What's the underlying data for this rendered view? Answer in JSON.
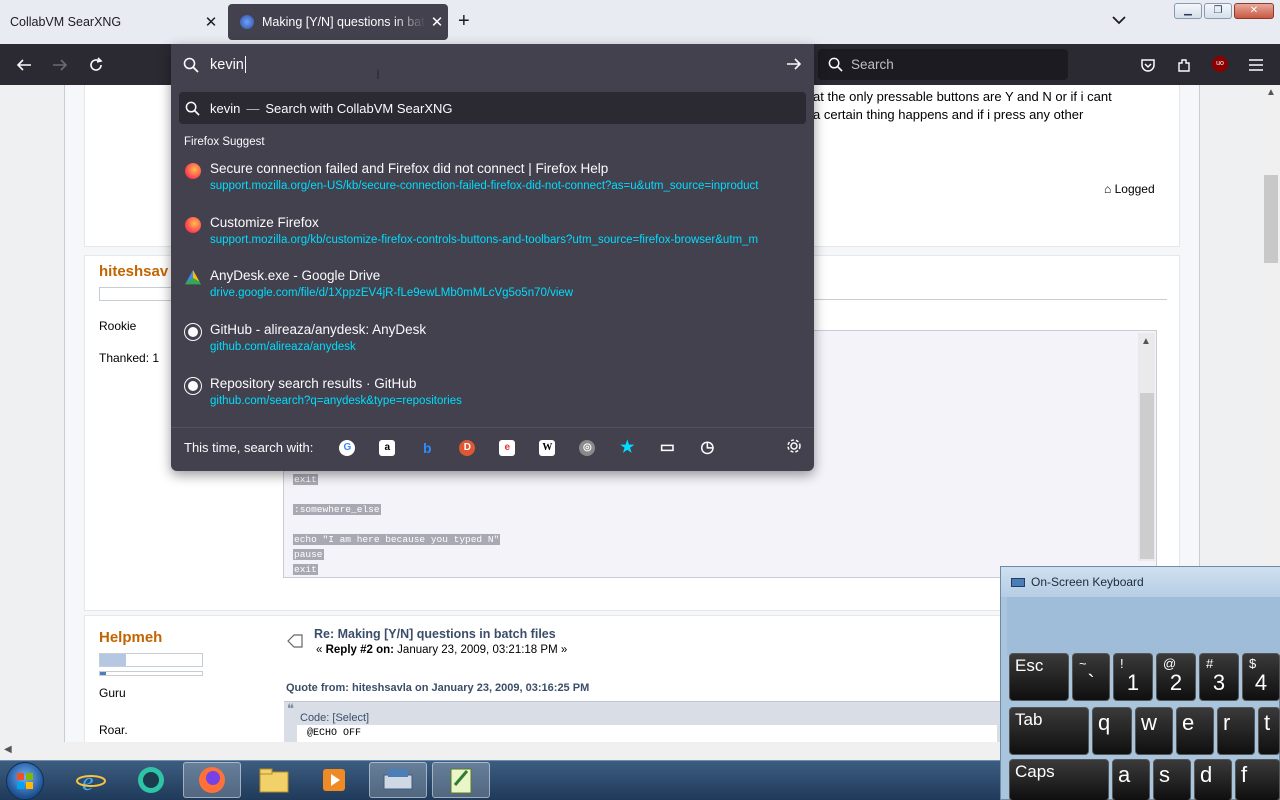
{
  "tabs": [
    {
      "title": "CollabVM SearXNG",
      "close": "✕"
    },
    {
      "title": "Making [Y/N] questions in batch files",
      "close": "✕"
    }
  ],
  "toolbar": {
    "new_tab": "+",
    "search_placeholder": "Search",
    "ublock_badge": "uo"
  },
  "urlbar": {
    "value": "kevin",
    "selected_row": {
      "text": "kevin",
      "dash": "—",
      "action": "Search with CollabVM SearXNG"
    },
    "group_label": "Firefox Suggest",
    "suggestions": [
      {
        "icon": "firefox-icon",
        "title": "Secure connection failed and Firefox did not connect | Firefox Help",
        "url": "support.mozilla.org/en-US/kb/secure-connection-failed-firefox-did-not-connect?as=u&utm_source=inproduct",
        "color": "#ff7139"
      },
      {
        "icon": "firefox-star-icon",
        "title": "Customize Firefox",
        "url": "support.mozilla.org/kb/customize-firefox-controls-buttons-and-toolbars?utm_source=firefox-browser&utm_m",
        "color": "#ff7139"
      },
      {
        "icon": "google-drive-icon",
        "title": "AnyDesk.exe - Google Drive",
        "url": "drive.google.com/file/d/1XppzEV4jR-fLe9ewLMb0mMLcVg5o5n70/view",
        "color": "#34a853"
      },
      {
        "icon": "github-icon",
        "title": "GitHub - alireaza/anydesk: AnyDesk",
        "url": "github.com/alireaza/anydesk",
        "color": "#ffffff"
      },
      {
        "icon": "github-icon",
        "title": "Repository search results · GitHub",
        "url": "github.com/search?q=anydesk&type=repositories",
        "color": "#ffffff"
      }
    ],
    "search_with_label": "This time, search with:",
    "engines": [
      {
        "name": "google-icon",
        "glyph": "G",
        "bg": "#ffffff",
        "fg": "#4285f4"
      },
      {
        "name": "amazon-icon",
        "glyph": "a",
        "bg": "#ffffff",
        "fg": "#000000"
      },
      {
        "name": "bing-icon",
        "glyph": "b",
        "bg": "transparent",
        "fg": "#2b8cff"
      },
      {
        "name": "duckduckgo-icon",
        "glyph": "D",
        "bg": "#de5833",
        "fg": "#ffffff"
      },
      {
        "name": "ebay-icon",
        "glyph": "e",
        "bg": "#ffffff",
        "fg": "#e53238"
      },
      {
        "name": "wikipedia-icon",
        "glyph": "W",
        "bg": "#ffffff",
        "fg": "#000000"
      },
      {
        "name": "searxng-icon",
        "glyph": "◎",
        "bg": "#8a8a8a",
        "fg": "#ffffff"
      },
      {
        "name": "bookmarks-icon",
        "glyph": "★",
        "bg": "transparent",
        "fg": "#00ddff"
      },
      {
        "name": "tabs-icon",
        "glyph": "▭",
        "bg": "transparent",
        "fg": "#fbfbfe"
      },
      {
        "name": "history-icon",
        "glyph": "◷",
        "bg": "transparent",
        "fg": "#fbfbfe"
      }
    ]
  },
  "page": {
    "post_text_1": "at the only pressable buttons are Y and N or if i cant",
    "post_text_2": "a certain thing happens and if i press any other",
    "logged": "Logged",
    "user1": {
      "name": "hiteshsav",
      "rank": "Rookie",
      "thanked": "Thanked: 1"
    },
    "code_lines": [
      "exit",
      ":somewhere_else",
      "echo \"I am here because you typed N\"",
      "pause",
      "exit"
    ],
    "user2": {
      "name": "Helpmeh",
      "rank": "Guru",
      "extra": "Roar."
    },
    "reply_title": "Re: Making [Y/N] questions in batch files",
    "reply_prefix": "« ",
    "reply_label": "Reply #2 on:",
    "reply_date": " January 23, 2009, 03:21:18 PM »",
    "quote_from": "Quote from: hiteshsavla on January 23, 2009, 03:16:25 PM",
    "code_label": "Code: [Select]",
    "code_first": "@ECHO OFF"
  },
  "osk": {
    "title": "On-Screen Keyboard",
    "keys": [
      {
        "label": "Esc",
        "type": "lab"
      },
      {
        "small": "~",
        "big": "`"
      },
      {
        "small": "!",
        "big": "1"
      },
      {
        "small": "@",
        "big": "2"
      },
      {
        "small": "#",
        "big": "3"
      },
      {
        "small": "$",
        "big": "4"
      },
      {
        "label": "Tab",
        "type": "lab"
      },
      {
        "big": "q"
      },
      {
        "big": "w"
      },
      {
        "big": "e"
      },
      {
        "big": "r"
      },
      {
        "big": "t"
      },
      {
        "label": "Caps",
        "type": "lab"
      },
      {
        "big": "a"
      },
      {
        "big": "s"
      },
      {
        "big": "d"
      },
      {
        "big": "f"
      }
    ]
  },
  "taskbar": {
    "items": [
      "internet-explorer-icon",
      "chat-app-icon",
      "firefox-icon",
      "file-explorer-icon",
      "media-player-icon",
      "keyboard-app-icon",
      "notepad-icon"
    ]
  }
}
